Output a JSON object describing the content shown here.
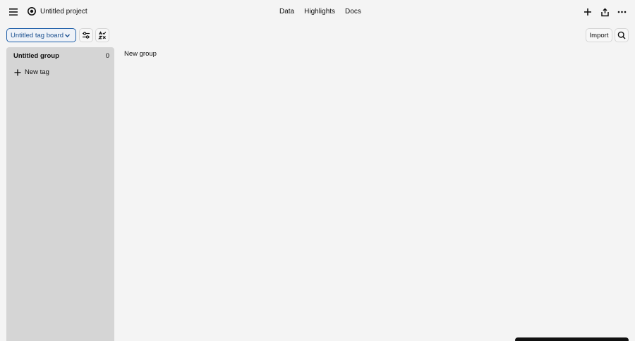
{
  "header": {
    "project_title": "Untitled project",
    "nav": [
      "Data",
      "Highlights",
      "Docs"
    ],
    "icons": [
      "menu-icon",
      "project-status-icon",
      "plus-icon",
      "share-icon",
      "more-icon"
    ]
  },
  "toolbar": {
    "board_name": "Untitled tag board",
    "import_label": "Import",
    "icons": [
      "chevron-down-icon",
      "filter-settings-icon",
      "sort-icon",
      "search-icon"
    ]
  },
  "board": {
    "group": {
      "title": "Untitled group",
      "count": "0",
      "new_tag_label": "New tag"
    },
    "new_group_label": "New group"
  },
  "colors": {
    "accent": "#1f5fa8",
    "background": "#f4f4f4",
    "group_bg": "#d5d5d5"
  }
}
